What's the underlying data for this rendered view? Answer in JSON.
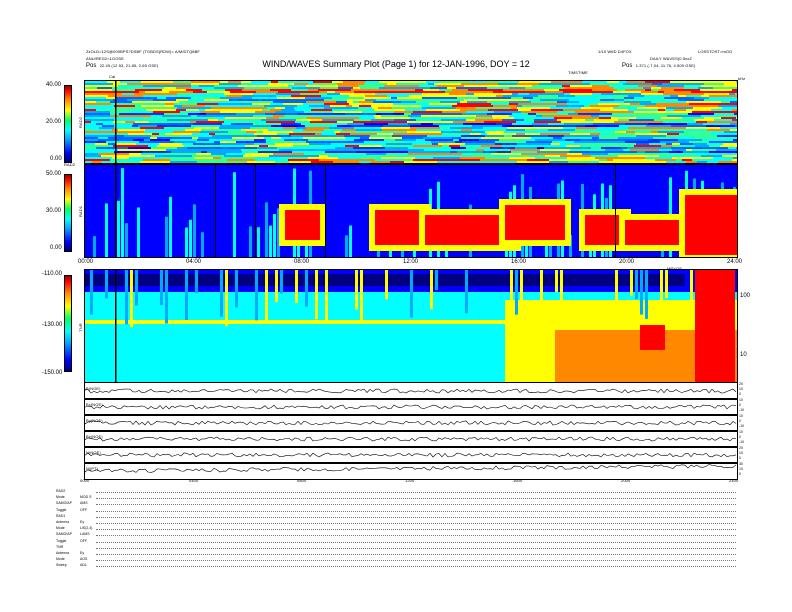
{
  "header": {
    "left_line1": "ZzOLD=12S@000BPS?DSBF (TGBDS(RDW)= A/M/DTQ8BF",
    "left_line2": "ANU/REG2=1GOSE",
    "left_line3_label": "Pos",
    "left_line3_value": "22.49 (12.53, 21.85, 2.65 GSE)",
    "title": "WIND/WAVES Summary Plot (Page 1) for 12-JAN-1996, DOY = 12",
    "right_line1_a": "1/10 W6D D4FOX",
    "right_line1_b": "LOSSTOST=mOO",
    "right_line2": "DAILY W&VES(0.5xxZ",
    "right_line3_label": "Pos",
    "right_line3_value": "1.371 (-7.04, 11.76, 4.509 GSE)",
    "timetag": "TIMSTIME",
    "khz_label": "kHz",
    "cal_label": "Cal"
  },
  "colors": {
    "background": "#ffffff",
    "low": "#0000ff",
    "mid": "#00ffff",
    "high": "#ff0000",
    "axis": "#000000"
  },
  "chart_data": [
    {
      "type": "heatmap",
      "name": "RAD2",
      "ylabel": "RAD2",
      "y_ticks": [
        "40.00",
        "20.00",
        "0.00"
      ],
      "ylim": [
        0,
        40
      ]
    },
    {
      "type": "heatmap",
      "name": "RAD1",
      "ylabel": "RAD1",
      "y_ticks": [
        "50.00",
        "30.00",
        "0.00"
      ],
      "ylim": [
        0,
        50
      ],
      "x_ticks": [
        "00:00",
        "04:00",
        "08:00",
        "12:00",
        "16:00",
        "20:00",
        "24:00"
      ],
      "x_ticks_right_label": "MRYOE"
    },
    {
      "type": "heatmap",
      "name": "TNR",
      "ylabel": "TNR",
      "y_ticks": [
        "-110.00",
        "-130.00",
        "-150.00"
      ],
      "ylim": [
        -150,
        -110
      ],
      "right_ticks": [
        "100",
        "10"
      ]
    },
    {
      "type": "line",
      "name": "Magnetometer",
      "strips": [
        {
          "label": "B(NOE)",
          "right_ticks": [
            "20",
            "10",
            "0"
          ]
        },
        {
          "label": "Bx(NOE)",
          "right_ticks": [
            "10",
            "0",
            "-10"
          ]
        },
        {
          "label": "By(NOE)",
          "right_ticks": [
            "10",
            "0",
            "-10"
          ]
        },
        {
          "label": "Bz(NOE)",
          "right_ticks": [
            "10",
            "0",
            "-10"
          ]
        },
        {
          "label": "N(NOE)",
          "right_ticks": [
            "20",
            "10",
            "0"
          ]
        },
        {
          "label": "Ni(PT)",
          "right_ticks": [
            "30",
            "10",
            "0"
          ]
        }
      ],
      "x_ticks": [
        "0000",
        "0400",
        "0800",
        "1200",
        "1600",
        "2000",
        "2400"
      ]
    }
  ],
  "status_rows": [
    {
      "label": "RAD2",
      "value": ""
    },
    {
      "label": "Mode",
      "value": "MOD S"
    },
    {
      "label": "SAMO/AP",
      "value": "AMS"
    },
    {
      "label": "Toggle",
      "value": "OFF"
    },
    {
      "label": "RAD1",
      "value": ""
    },
    {
      "label": "Antenna",
      "value": "Ey"
    },
    {
      "label": "Mode",
      "value": "LIS(2,4)"
    },
    {
      "label": "SAMO/AP",
      "value": "LAMS"
    },
    {
      "label": "Toggle",
      "value": "OFF"
    },
    {
      "label": "TNR",
      "value": ""
    },
    {
      "label": "Antenna",
      "value": "Ey"
    },
    {
      "label": "Mode",
      "value": "AOS"
    },
    {
      "label": "Sweep",
      "value": "ADL"
    }
  ]
}
